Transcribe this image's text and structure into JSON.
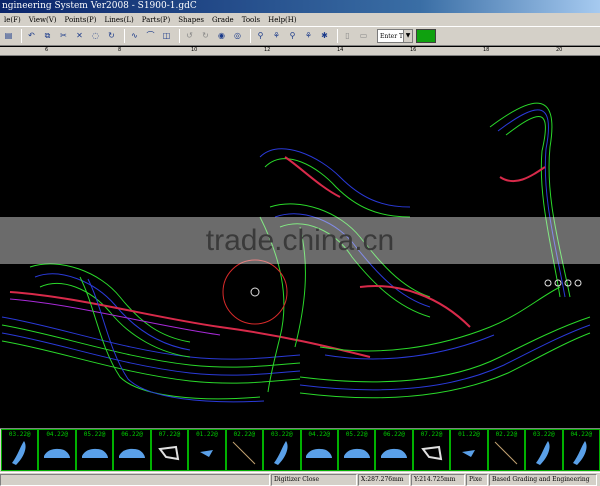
{
  "window": {
    "title": "ngineering System Ver2008 - S1900-1.gdC"
  },
  "menu": [
    "le(F)",
    "View(V)",
    "Points(P)",
    "Lines(L)",
    "Parts(P)",
    "Shapes",
    "Grade",
    "Tools",
    "Help(H)"
  ],
  "toolbar": {
    "icons": [
      "disk-icon",
      "undo-icon",
      "copy-icon",
      "scissors-icon",
      "cut-icon",
      "lasso-icon",
      "rotate-icon",
      "curve-icon",
      "fold-icon",
      "snap-icon",
      "gray-tool-icon",
      "gray-tool-icon",
      "eye-icon",
      "eye-icon",
      "person-icon",
      "person-icon",
      "person-icon",
      "person-icon",
      "page-icon",
      "save-icon"
    ],
    "enter_value": "Enter T",
    "accent_color": "#0fa10f"
  },
  "ruler": {
    "labels": [
      "6",
      "8",
      "10",
      "12",
      "14",
      "16",
      "18",
      "20"
    ]
  },
  "watermark": {
    "text": "trade.china.cn"
  },
  "thumbnails": [
    {
      "size": "03.22@",
      "shape": "sole"
    },
    {
      "size": "04.22@",
      "shape": "shoe"
    },
    {
      "size": "05.22@",
      "shape": "shoe"
    },
    {
      "size": "06.22@",
      "shape": "shoe"
    },
    {
      "size": "07.22@",
      "shape": "clip"
    },
    {
      "size": "01.22@",
      "shape": "small"
    },
    {
      "size": "02.22@",
      "shape": "line"
    },
    {
      "size": "03.22@",
      "shape": "sole"
    },
    {
      "size": "04.22@",
      "shape": "shoe"
    },
    {
      "size": "05.22@",
      "shape": "shoe"
    },
    {
      "size": "06.22@",
      "shape": "shoe"
    },
    {
      "size": "07.22@",
      "shape": "clip"
    },
    {
      "size": "01.22@",
      "shape": "small"
    },
    {
      "size": "02.22@",
      "shape": "line"
    },
    {
      "size": "03.22@",
      "shape": "sole"
    },
    {
      "size": "04.22@",
      "shape": "sole"
    }
  ],
  "status": {
    "mode": "Digitizer Close",
    "x": "X:287.276mm",
    "y": "Y:214.725mm",
    "extra": "Pixe",
    "app": "Based Grading and Engineering"
  }
}
